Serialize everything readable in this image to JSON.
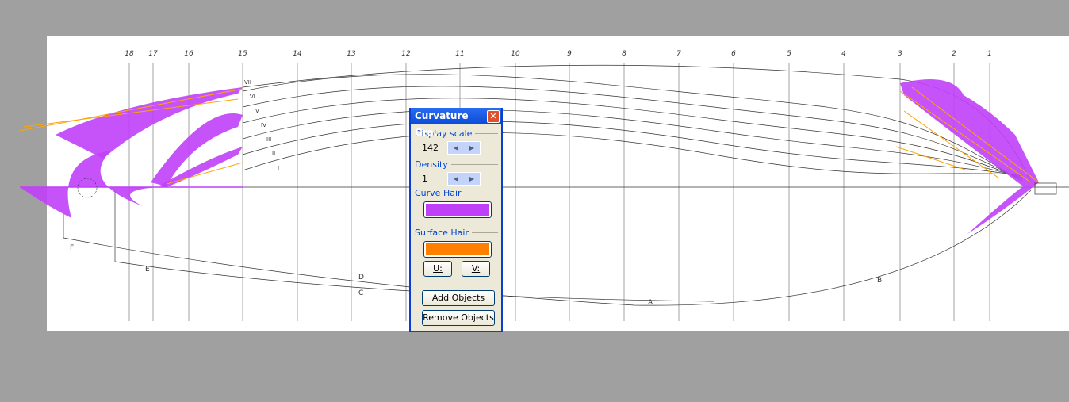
{
  "drawing": {
    "stations": [
      "18",
      "17",
      "16",
      "15",
      "14",
      "13",
      "12",
      "11",
      "10",
      "9",
      "8",
      "7",
      "6",
      "5",
      "4",
      "3",
      "2",
      "1"
    ],
    "waterlines": [
      "VII",
      "VI",
      "V",
      "IV",
      "III",
      "II",
      "I"
    ],
    "section_labels": [
      "F",
      "E",
      "D",
      "C",
      "A",
      "B"
    ],
    "curve_hair_color": "#c040f8",
    "surface_hair_color": "#ffa500"
  },
  "dialog": {
    "title": "Curvature Gra...",
    "display_scale_label": "Display scale",
    "display_scale_value": "142",
    "density_label": "Density",
    "density_value": "1",
    "curve_hair_label": "Curve Hair",
    "curve_hair_color": "#c040f8",
    "surface_hair_label": "Surface Hair",
    "surface_hair_color": "#ff8000",
    "u_label": "U:",
    "v_label": "V:",
    "add_objects": "Add Objects",
    "remove_objects": "Remove Objects"
  }
}
